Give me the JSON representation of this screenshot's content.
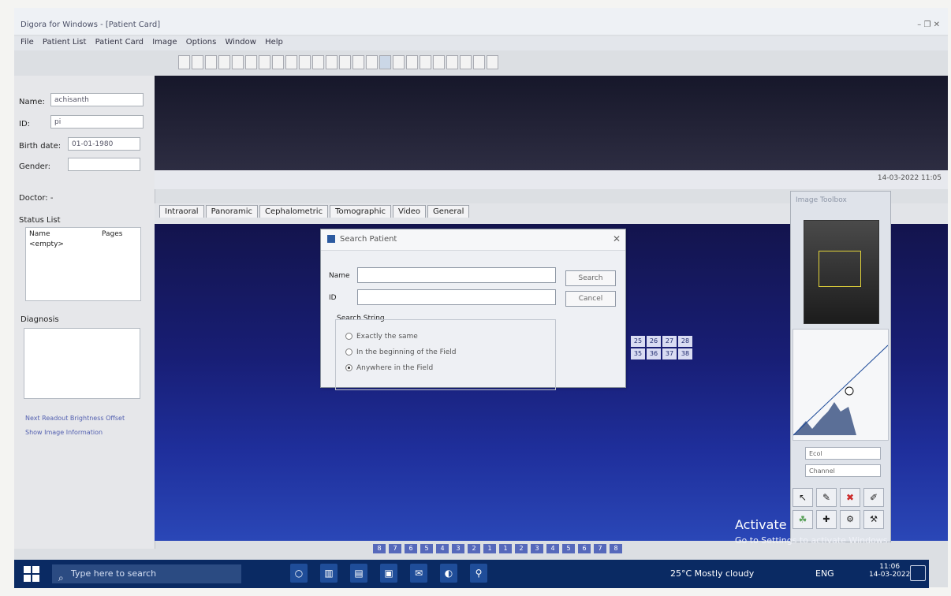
{
  "window": {
    "title": "Digora for Windows - [Patient Card]",
    "menu": [
      "File",
      "Patient List",
      "Patient Card",
      "Image",
      "Options",
      "Window",
      "Help"
    ],
    "controls": [
      "–",
      "❐",
      "✕"
    ]
  },
  "left_panel": {
    "name_label": "Name:",
    "name_value": "achisanth",
    "id_label": "ID:",
    "id_value": "pi",
    "birth_label": "Birth date:",
    "birth_value": "01-01-1980",
    "gender_label": "Gender:",
    "doctor_label": "Doctor: -",
    "status_list_label": "Status List",
    "status_cols": [
      "Name",
      "Pages"
    ],
    "status_row": [
      "<empty>",
      ""
    ],
    "diagnosis_label": "Diagnosis",
    "checkbox_1": "Next Readout Brightness Offset",
    "checkbox_2": "Show Image Information"
  },
  "timestamp": "14-03-2022 11:05",
  "tabs": [
    "Intraoral",
    "Panoramic",
    "Cephalometric",
    "Tomographic",
    "Video",
    "General"
  ],
  "dialog": {
    "title": "Search Patient",
    "name_label": "Name",
    "id_label": "ID",
    "search_button": "Search",
    "cancel_button": "Cancel",
    "group_label": "Search String",
    "options": [
      "Exactly the same",
      "In the beginning of the Field",
      "Anywhere in the Field"
    ]
  },
  "tooth_grid": {
    "row1": [
      "25",
      "26",
      "27",
      "28"
    ],
    "row2": [
      "35",
      "36",
      "37",
      "38"
    ]
  },
  "bottom_numbers": [
    "8",
    "7",
    "6",
    "5",
    "4",
    "3",
    "2",
    "1",
    "1",
    "2",
    "3",
    "4",
    "5",
    "6",
    "7",
    "8"
  ],
  "right_panel": {
    "title": "Image Toolbox",
    "dropdown_1": "Ecol",
    "dropdown_2": "Channel"
  },
  "activate": {
    "line1": "Activate",
    "line2": "Go to Settings to activate Windows."
  },
  "taskbar": {
    "search_placeholder": "Type here to search",
    "weather": "25°C  Mostly cloudy",
    "lang": "ENG",
    "time": "11:06",
    "date": "14-03-2022"
  }
}
